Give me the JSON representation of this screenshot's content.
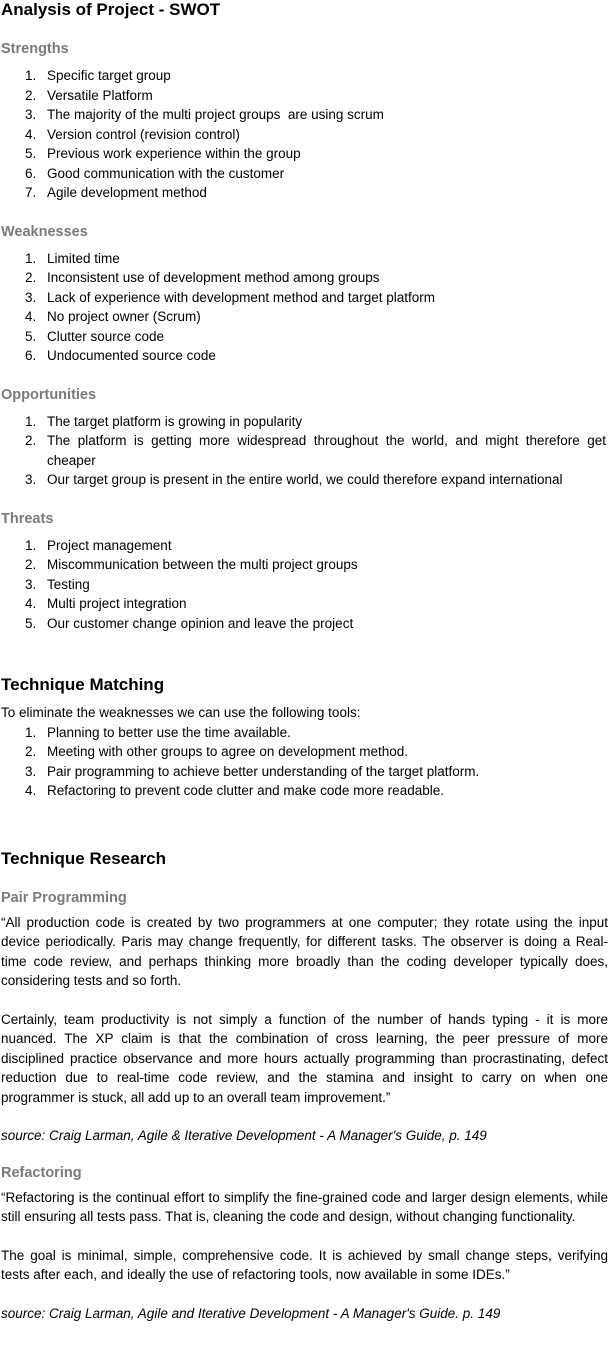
{
  "title": "Analysis of Project - SWOT",
  "swot": [
    {
      "heading": "Strengths",
      "items": [
        "Specific target group",
        "Versatile Platform",
        "The majority of the multi project groups  are using scrum",
        "Version control (revision control)",
        "Previous work experience within the group",
        "Good communication with the customer",
        "Agile development method"
      ]
    },
    {
      "heading": "Weaknesses",
      "items": [
        "Limited time",
        "Inconsistent use of development method among groups",
        "Lack of experience with development method and target platform",
        "No project owner (Scrum)",
        "Clutter source code",
        "Undocumented source code"
      ]
    },
    {
      "heading": "Opportunities",
      "items": [
        "The target platform is growing in popularity",
        "The platform is getting more widespread throughout the world, and might therefore get cheaper",
        "Our target group is present in the entire world, we could therefore expand international"
      ]
    },
    {
      "heading": "Threats",
      "items": [
        "Project management",
        "Miscommunication between the multi project groups",
        "Testing",
        "Multi project integration",
        "Our customer change opinion and leave the project"
      ]
    }
  ],
  "matching": {
    "heading": "Technique Matching",
    "intro": "To eliminate the weaknesses we can use the following tools:",
    "items": [
      "Planning to better use the time available.",
      "Meeting with other groups to agree on development method.",
      "Pair programming to achieve better understanding of the target platform.",
      "Refactoring to prevent code clutter and make code more readable."
    ]
  },
  "research": {
    "heading": "Technique Research",
    "pair": {
      "heading": "Pair Programming",
      "quote1": "“All production code is created by two programmers at one computer; they rotate using the input device periodically. Paris may change frequently, for different tasks. The observer is doing a Real-time code review, and perhaps thinking more broadly than the coding developer typically does, considering tests and so forth.",
      "quote2": "Certainly, team productivity is not simply a function of the number of hands typing - it is more nuanced. The XP claim is that the combination of cross learning, the peer pressure of more disciplined practice observance and more hours actually programming than procrastinating, defect reduction due to real-time code review, and the stamina and insight to carry on when one programmer is stuck, all add up to an overall team improvement.”",
      "source": "source: Craig Larman, Agile & Iterative Development - A Manager's Guide, p. 149"
    },
    "refactoring": {
      "heading": "Refactoring",
      "quote1": "“Refactoring is the continual effort to simplify the fine-grained code and larger design elements, while still ensuring all tests pass. That is, cleaning the code and design, without changing functionality.",
      "quote2": "The goal is minimal, simple, comprehensive code. It is achieved by small change steps, verifying tests after each, and ideally the use of refactoring tools, now available in some IDEs.”",
      "source": "source: Craig Larman, Agile and Iterative Development - A Manager's Guide. p. 149"
    }
  }
}
